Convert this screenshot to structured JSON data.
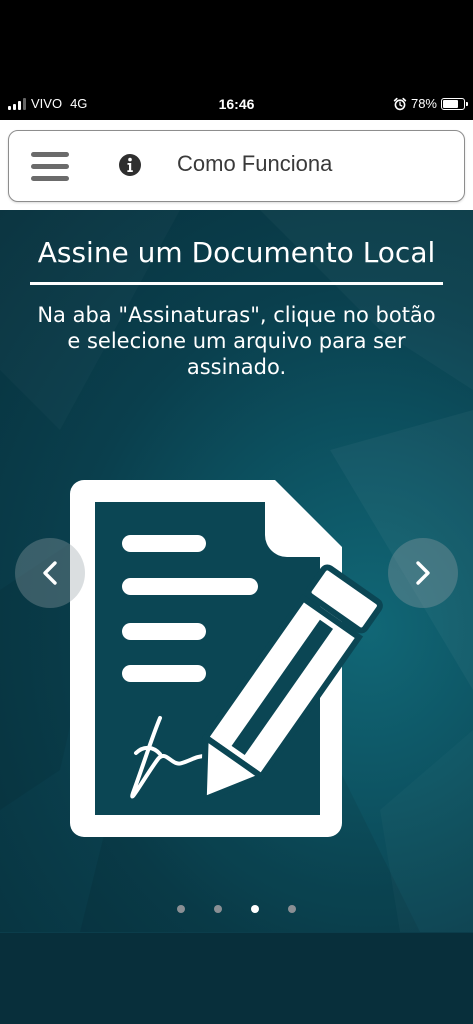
{
  "status_bar": {
    "carrier": "VIVO",
    "network": "4G",
    "time": "16:46",
    "battery_percent_label": "78%",
    "battery_level": 0.78,
    "alarm_icon": "alarm-clock-icon",
    "signal_icon": "cellular-signal-icon"
  },
  "header": {
    "menu_icon": "hamburger-menu-icon",
    "info_icon": "info-circle-icon",
    "title": "Como Funciona"
  },
  "slide": {
    "title": "Assine um Documento Local",
    "description": "Na aba \"Assinaturas\", clique no botão   e selecione um arquivo para ser assinado.",
    "illustration_icon": "document-signature-pen-icon",
    "prev_icon": "chevron-left-icon",
    "next_icon": "chevron-right-icon"
  },
  "pagination": {
    "total": 4,
    "active_index": 2
  },
  "colors": {
    "background_dark": "#07313d",
    "background_teal": "#116776",
    "header_text": "#3a3a3a",
    "menu_icon": "#6b6b6b",
    "dot_inactive": "#8a8f94",
    "dot_active": "#ffffff"
  }
}
